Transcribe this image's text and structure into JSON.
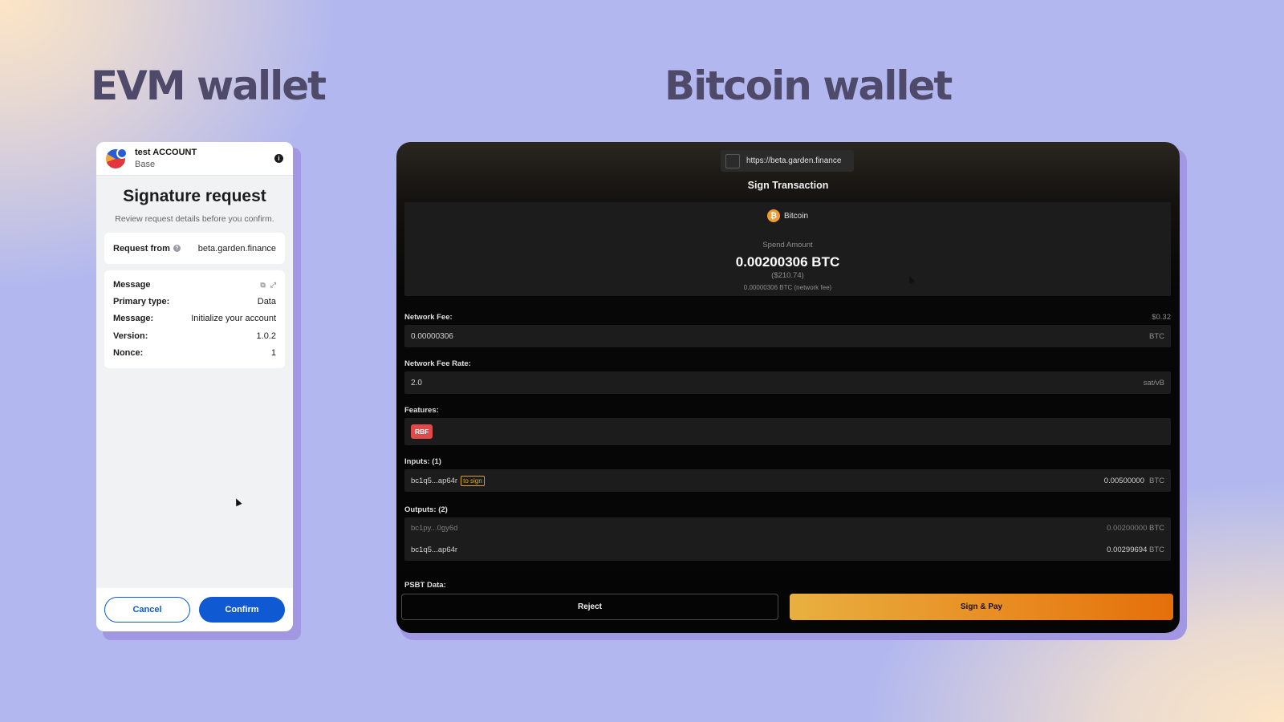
{
  "headings": {
    "evm": "EVM wallet",
    "bitcoin": "Bitcoin wallet"
  },
  "evm": {
    "account_name": "test ACCOUNT",
    "network": "Base",
    "title": "Signature request",
    "subtitle": "Review request details before you confirm.",
    "request_from_label": "Request from",
    "request_from_value": "beta.garden.finance",
    "message_header": "Message",
    "rows": [
      {
        "key": "Primary type:",
        "value": "Data"
      },
      {
        "key": "Message:",
        "value": "Initialize your account"
      },
      {
        "key": "Version:",
        "value": "1.0.2"
      },
      {
        "key": "Nonce:",
        "value": "1"
      }
    ],
    "cancel_label": "Cancel",
    "confirm_label": "Confirm"
  },
  "btc": {
    "url": "https://beta.garden.finance",
    "title": "Sign Transaction",
    "network": "Bitcoin",
    "spend_label": "Spend Amount",
    "spend_amount": "0.00200306 BTC",
    "spend_usd": "($210.74)",
    "spend_fee": "0.00000306 BTC (network fee)",
    "network_fee_label": "Network Fee:",
    "network_fee_usd": "$0.32",
    "network_fee_value": "0.00000306",
    "network_fee_unit": "BTC",
    "fee_rate_label": "Network Fee Rate:",
    "fee_rate_value": "2.0",
    "fee_rate_unit": "sat/vB",
    "features_label": "Features:",
    "feature_badge": "RBF",
    "inputs_label": "Inputs: (1)",
    "input": {
      "address": "bc1q5...ap64r",
      "tag": "to sign",
      "amount": "0.00500000",
      "unit": "BTC"
    },
    "outputs_label": "Outputs: (2)",
    "outputs": [
      {
        "address": "bc1py...0gy6d",
        "amount": "0.00200000",
        "unit": "BTC"
      },
      {
        "address": "bc1q5...ap64r",
        "amount": "0.00299694",
        "unit": "BTC"
      }
    ],
    "psbt_label": "PSBT Data:",
    "reject_label": "Reject",
    "pay_label": "Sign & Pay"
  },
  "icons": {
    "avatar": "account-avatar-icon",
    "info": "info-icon",
    "help": "question-icon",
    "copy": "copy-icon",
    "collapse": "collapse-icon",
    "bitcoin": "bitcoin-icon",
    "favicon": "site-favicon-icon"
  },
  "colors": {
    "primary_blue": "#0f5ad3",
    "bitcoin_orange": "#f39a2c",
    "rbf_red": "#e04a4a",
    "pay_gradient_start": "#e8b040",
    "pay_gradient_end": "#e56f0a"
  }
}
